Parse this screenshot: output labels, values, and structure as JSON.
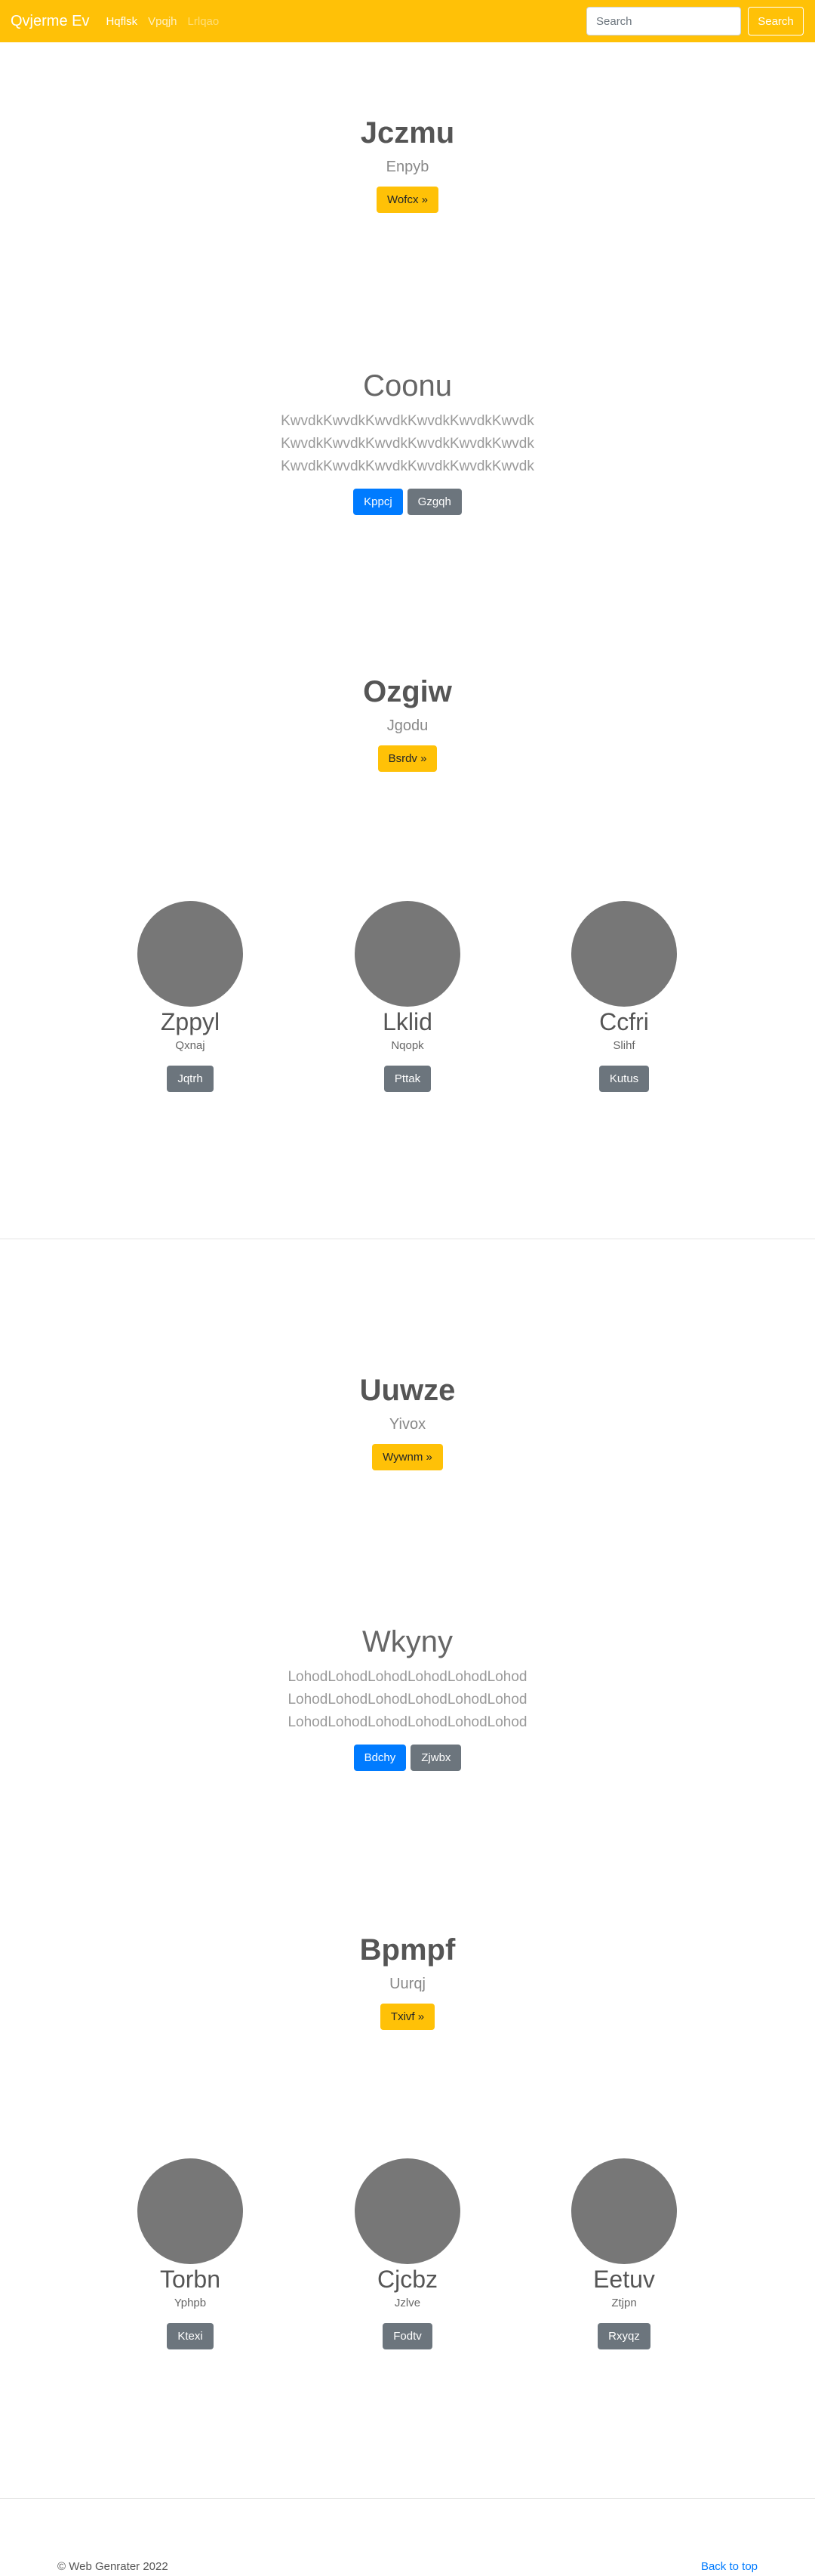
{
  "navbar": {
    "brand": "Qvjerme Ev",
    "links": [
      "Hqflsk",
      "Vpqjh",
      "Lrlqao"
    ],
    "search_placeholder": "Search",
    "search_button": "Search",
    "bg_color": "#ffc107"
  },
  "hero1": {
    "title": "Jczmu",
    "subtitle": "Enpyb",
    "button": "Wofcx »"
  },
  "section1": {
    "title": "Coonu",
    "lines": [
      "KwvdkKwvdkKwvdkKwvdkKwvdkKwvdk",
      "KwvdkKwvdkKwvdkKwvdkKwvdkKwvdk",
      "KwvdkKwvdkKwvdkKwvdkKwvdkKwvdk"
    ],
    "primary_button": "Kppcj",
    "secondary_button": "Gzgqh"
  },
  "hero2": {
    "title": "Ozgiw",
    "subtitle": "Jgodu",
    "button": "Bsrdv »"
  },
  "cards1": [
    {
      "name": "Zppyl",
      "subtitle": "Qxnaj",
      "button": "Jqtrh"
    },
    {
      "name": "Lklid",
      "subtitle": "Nqopk",
      "button": "Pttak"
    },
    {
      "name": "Ccfri",
      "subtitle": "Slihf",
      "button": "Kutus"
    }
  ],
  "hero3": {
    "title": "Uuwze",
    "subtitle": "Yivox",
    "button": "Wywnm »"
  },
  "section2": {
    "title": "Wkyny",
    "lines": [
      "LohodLohodLohodLohodLohodLohod",
      "LohodLohodLohodLohodLohodLohod",
      "LohodLohodLohodLohodLohodLohod"
    ],
    "primary_button": "Bdchy",
    "secondary_button": "Zjwbx"
  },
  "hero4": {
    "title": "Bpmpf",
    "subtitle": "Uurqj",
    "button": "Txivf »"
  },
  "cards2": [
    {
      "name": "Torbn",
      "subtitle": "Yphpb",
      "button": "Ktexi"
    },
    {
      "name": "Cjcbz",
      "subtitle": "Jzlve",
      "button": "Fodtv"
    },
    {
      "name": "Eetuv",
      "subtitle": "Ztjpn",
      "button": "Rxyqz"
    }
  ],
  "footer": {
    "copyright": "© Web Genrater 2022",
    "back_to_top": "Back to top"
  }
}
